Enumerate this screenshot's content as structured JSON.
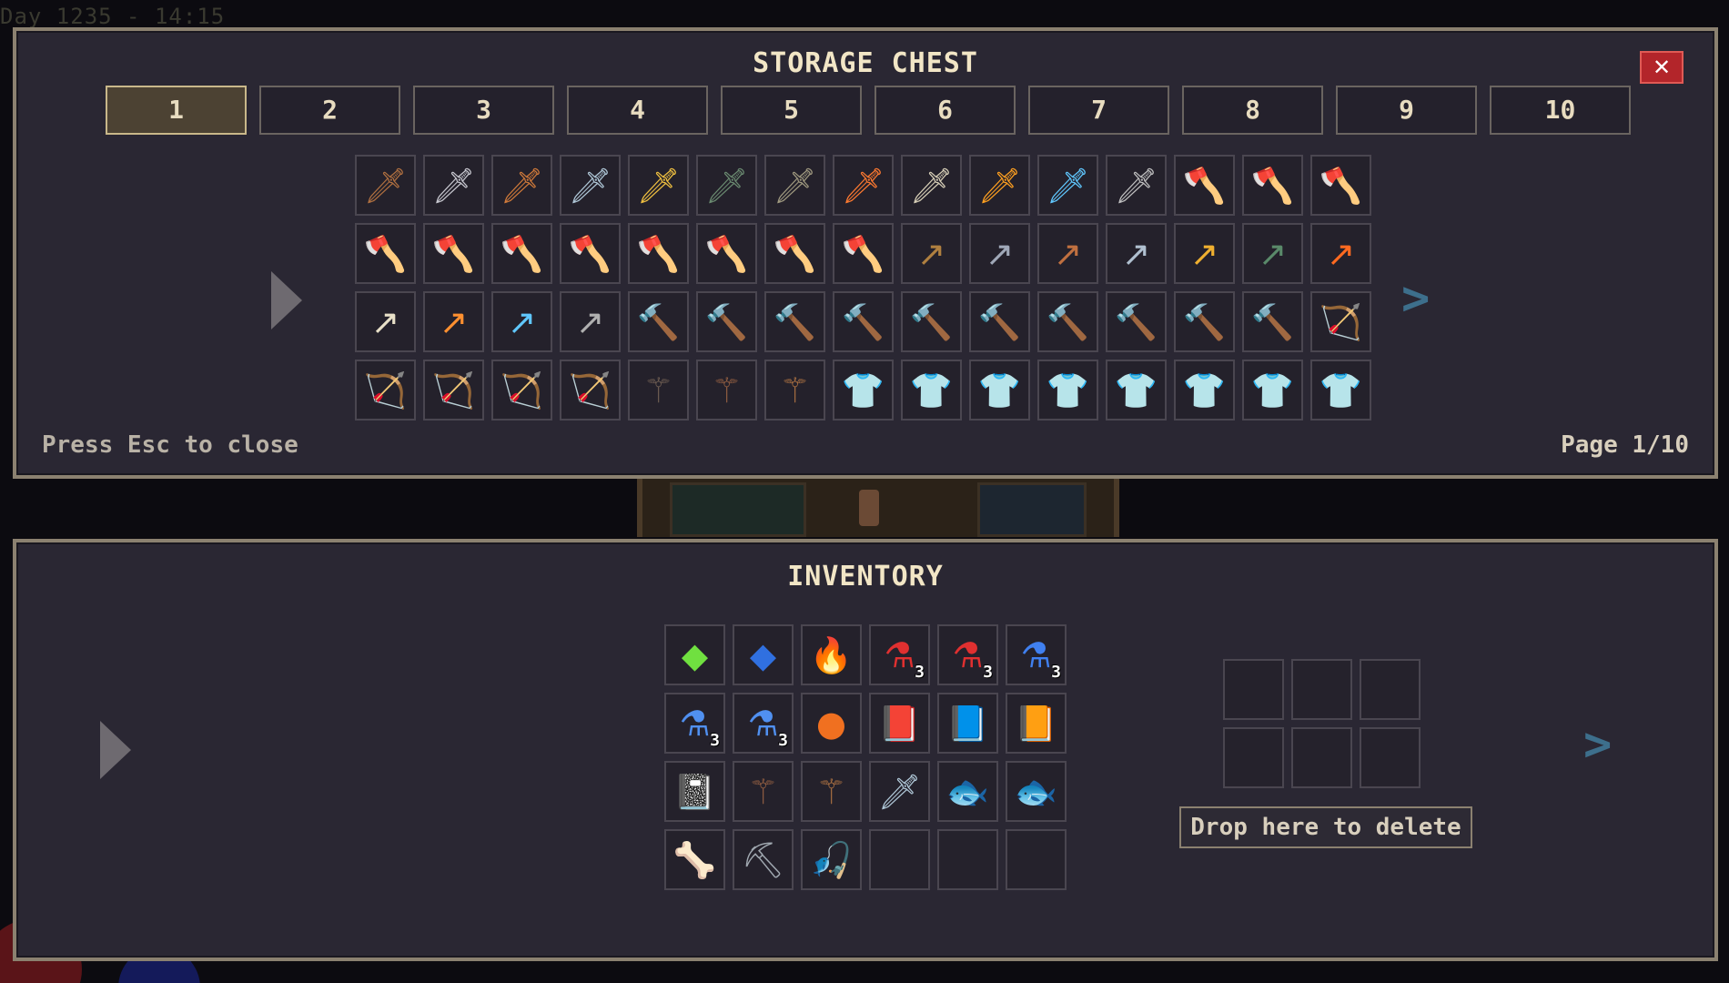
{
  "hud": {
    "day_label": "Day 1235 - 14:15"
  },
  "chest": {
    "title": "STORAGE CHEST",
    "close_label": "✕",
    "tabs": [
      {
        "label": "1",
        "active": true
      },
      {
        "label": "2",
        "active": false
      },
      {
        "label": "3",
        "active": false
      },
      {
        "label": "4",
        "active": false
      },
      {
        "label": "5",
        "active": false
      },
      {
        "label": "6",
        "active": false
      },
      {
        "label": "7",
        "active": false
      },
      {
        "label": "8",
        "active": false
      },
      {
        "label": "9",
        "active": false
      },
      {
        "label": "10",
        "active": false
      }
    ],
    "prev_icon": "play-left-icon",
    "next_label": ">",
    "hint": "Press Esc to close",
    "page": "Page 1/10",
    "items": [
      {
        "name": "wood-sword-icon",
        "glyph": "🗡",
        "color": "#b07040"
      },
      {
        "name": "iron-sword-icon",
        "glyph": "🗡",
        "color": "#c8c8d0"
      },
      {
        "name": "copper-sword-icon",
        "glyph": "🗡",
        "color": "#d07a3a"
      },
      {
        "name": "steel-sword-icon",
        "glyph": "🗡",
        "color": "#b0c8d8"
      },
      {
        "name": "gold-sword-icon",
        "glyph": "🗡",
        "color": "#f0c040"
      },
      {
        "name": "jade-sword-icon",
        "glyph": "🗡",
        "color": "#6a8a70"
      },
      {
        "name": "curved-blade-icon",
        "glyph": "🗡",
        "color": "#a09a80"
      },
      {
        "name": "fire-sword-icon",
        "glyph": "🗡",
        "color": "#ff7a30"
      },
      {
        "name": "bone-sword-icon",
        "glyph": "🗡",
        "color": "#d8d0b8"
      },
      {
        "name": "flame-sword-icon",
        "glyph": "🗡",
        "color": "#ffa020"
      },
      {
        "name": "ice-sword-icon",
        "glyph": "🗡",
        "color": "#60c8ff"
      },
      {
        "name": "dark-sword-icon",
        "glyph": "🗡",
        "color": "#c0c0c0"
      },
      {
        "name": "wood-axe-icon",
        "glyph": "🪓",
        "color": "#a07040"
      },
      {
        "name": "iron-axe-icon",
        "glyph": "🪓",
        "color": "#a0a8b8"
      },
      {
        "name": "copper-axe-icon",
        "glyph": "🪓",
        "color": "#c87a40"
      },
      {
        "name": "steel-axe-icon",
        "glyph": "🪓",
        "color": "#a8b0c0"
      },
      {
        "name": "gold-axe-icon",
        "glyph": "🪓",
        "color": "#f0c030"
      },
      {
        "name": "jade-axe-icon",
        "glyph": "🪓",
        "color": "#5a7a60"
      },
      {
        "name": "war-axe-icon",
        "glyph": "🪓",
        "color": "#8a7060"
      },
      {
        "name": "fire-axe-icon",
        "glyph": "🪓",
        "color": "#ff7020"
      },
      {
        "name": "flame-axe-icon",
        "glyph": "🪓",
        "color": "#ff9020"
      },
      {
        "name": "ice-axe-icon",
        "glyph": "🪓",
        "color": "#60c0ff"
      },
      {
        "name": "dark-axe-icon",
        "glyph": "🪓",
        "color": "#909090"
      },
      {
        "name": "wood-spear-icon",
        "glyph": "↗",
        "color": "#b08040"
      },
      {
        "name": "iron-spear-icon",
        "glyph": "↗",
        "color": "#a0a8b8"
      },
      {
        "name": "copper-spear-icon",
        "glyph": "↗",
        "color": "#c07040"
      },
      {
        "name": "steel-spear-icon",
        "glyph": "↗",
        "color": "#b0c0d0"
      },
      {
        "name": "gold-spear-icon",
        "glyph": "↗",
        "color": "#f0b030"
      },
      {
        "name": "jade-spear-icon",
        "glyph": "↗",
        "color": "#5a8a6a"
      },
      {
        "name": "fire-spear-icon",
        "glyph": "↗",
        "color": "#ff6a20"
      },
      {
        "name": "bone-spear-icon",
        "glyph": "↗",
        "color": "#e8e0c8"
      },
      {
        "name": "flame-spear-icon",
        "glyph": "↗",
        "color": "#ff9030"
      },
      {
        "name": "ice-spear-icon",
        "glyph": "↗",
        "color": "#60c8ff"
      },
      {
        "name": "dark-spear-icon",
        "glyph": "↗",
        "color": "#b0b0b0"
      },
      {
        "name": "wood-hammer-icon",
        "glyph": "🔨",
        "color": "#a07040"
      },
      {
        "name": "iron-hammer-icon",
        "glyph": "🔨",
        "color": "#a0a8b8"
      },
      {
        "name": "copper-hammer-icon",
        "glyph": "🔨",
        "color": "#c07a40"
      },
      {
        "name": "steel-hammer-icon",
        "glyph": "🔨",
        "color": "#b0c0d0"
      },
      {
        "name": "gold-hammer-icon",
        "glyph": "🔨",
        "color": "#f0c030"
      },
      {
        "name": "jade-hammer-icon",
        "glyph": "🔨",
        "color": "#5a7a60"
      },
      {
        "name": "fire-hammer-icon",
        "glyph": "🔨",
        "color": "#ff6a20"
      },
      {
        "name": "flame-hammer-icon",
        "glyph": "🔨",
        "color": "#ff9020"
      },
      {
        "name": "ice-hammer-icon",
        "glyph": "🔨",
        "color": "#60c0ff"
      },
      {
        "name": "dark-hammer-icon",
        "glyph": "🔨",
        "color": "#808080"
      },
      {
        "name": "wood-bow-icon",
        "glyph": "🏹",
        "color": "#a07040"
      },
      {
        "name": "iron-bow-icon",
        "glyph": "🏹",
        "color": "#c8c0b0"
      },
      {
        "name": "fire-bow-icon",
        "glyph": "🏹",
        "color": "#ff6a20"
      },
      {
        "name": "ice-bow-icon",
        "glyph": "🏹",
        "color": "#60c8ff"
      },
      {
        "name": "bone-bow-icon",
        "glyph": "🏹",
        "color": "#d8d0b8"
      },
      {
        "name": "dark-staff-icon",
        "glyph": "⚚",
        "color": "#6a5a50"
      },
      {
        "name": "wood-staff-icon",
        "glyph": "⚚",
        "color": "#8a5a40"
      },
      {
        "name": "copper-staff-icon",
        "glyph": "⚚",
        "color": "#a06a40"
      },
      {
        "name": "leather-armor-icon",
        "glyph": "👕",
        "color": "#7a5030"
      },
      {
        "name": "iron-armor-icon",
        "glyph": "👕",
        "color": "#a0a8b8"
      },
      {
        "name": "copper-armor-icon",
        "glyph": "👕",
        "color": "#c07040"
      },
      {
        "name": "steel-armor-icon",
        "glyph": "👕",
        "color": "#b0c0d0"
      },
      {
        "name": "gold-armor-icon",
        "glyph": "👕",
        "color": "#f0c030"
      },
      {
        "name": "jade-armor-icon",
        "glyph": "👕",
        "color": "#4a6a50"
      },
      {
        "name": "bone-armor-icon",
        "glyph": "👕",
        "color": "#d8c8a8"
      },
      {
        "name": "fire-armor-icon",
        "glyph": "👕",
        "color": "#e04030"
      }
    ]
  },
  "inventory": {
    "title": "INVENTORY",
    "prev_icon": "play-left-icon",
    "next_label": ">",
    "delete_label": "Drop here to delete",
    "items": [
      {
        "name": "green-gem-icon",
        "glyph": "◆",
        "color": "#70e040",
        "qty": ""
      },
      {
        "name": "blue-gem-icon",
        "glyph": "◆",
        "color": "#3070e0",
        "qty": ""
      },
      {
        "name": "torch-icon",
        "glyph": "🔥",
        "color": "#ff8030",
        "qty": ""
      },
      {
        "name": "red-potion-small-icon",
        "glyph": "⚗",
        "color": "#e03030",
        "qty": "3"
      },
      {
        "name": "red-potion-large-icon",
        "glyph": "⚗",
        "color": "#e03030",
        "qty": "3"
      },
      {
        "name": "blue-potion-small-icon",
        "glyph": "⚗",
        "color": "#4080f0",
        "qty": "3"
      },
      {
        "name": "blue-potion-medium-icon",
        "glyph": "⚗",
        "color": "#5090f0",
        "qty": "3"
      },
      {
        "name": "blue-potion-large-icon",
        "glyph": "⚗",
        "color": "#5090f0",
        "qty": "3"
      },
      {
        "name": "fire-orb-icon",
        "glyph": "●",
        "color": "#f07020",
        "qty": ""
      },
      {
        "name": "red-spellbook-icon",
        "glyph": "📕",
        "color": "#a03030",
        "qty": ""
      },
      {
        "name": "blue-spellbook-icon",
        "glyph": "📘",
        "color": "#5050a0",
        "qty": ""
      },
      {
        "name": "purple-spellbook-icon",
        "glyph": "📙",
        "color": "#7040a0",
        "qty": ""
      },
      {
        "name": "eye-tome-icon",
        "glyph": "📓",
        "color": "#6a4090",
        "qty": ""
      },
      {
        "name": "wood-staff-icon",
        "glyph": "⚚",
        "color": "#8a5a40",
        "qty": ""
      },
      {
        "name": "copper-staff-icon",
        "glyph": "⚚",
        "color": "#a06a40",
        "qty": ""
      },
      {
        "name": "steel-sword-icon",
        "glyph": "🗡",
        "color": "#b0c8d8",
        "qty": ""
      },
      {
        "name": "goldfish-icon",
        "glyph": "🐟",
        "color": "#f08020",
        "qty": ""
      },
      {
        "name": "bass-fish-icon",
        "glyph": "🐟",
        "color": "#60a090",
        "qty": ""
      },
      {
        "name": "fish-bone-icon",
        "glyph": "🦴",
        "color": "#d8c8a0",
        "qty": ""
      },
      {
        "name": "shovel-icon",
        "glyph": "⛏",
        "color": "#a0a8b0",
        "qty": ""
      },
      {
        "name": "fishing-rod-icon",
        "glyph": "🎣",
        "color": "#b07040",
        "qty": ""
      },
      {
        "name": "empty-slot",
        "glyph": "",
        "color": "",
        "qty": ""
      },
      {
        "name": "empty-slot",
        "glyph": "",
        "color": "",
        "qty": ""
      },
      {
        "name": "empty-slot",
        "glyph": "",
        "color": "",
        "qty": ""
      }
    ],
    "delete_slots": 6
  }
}
